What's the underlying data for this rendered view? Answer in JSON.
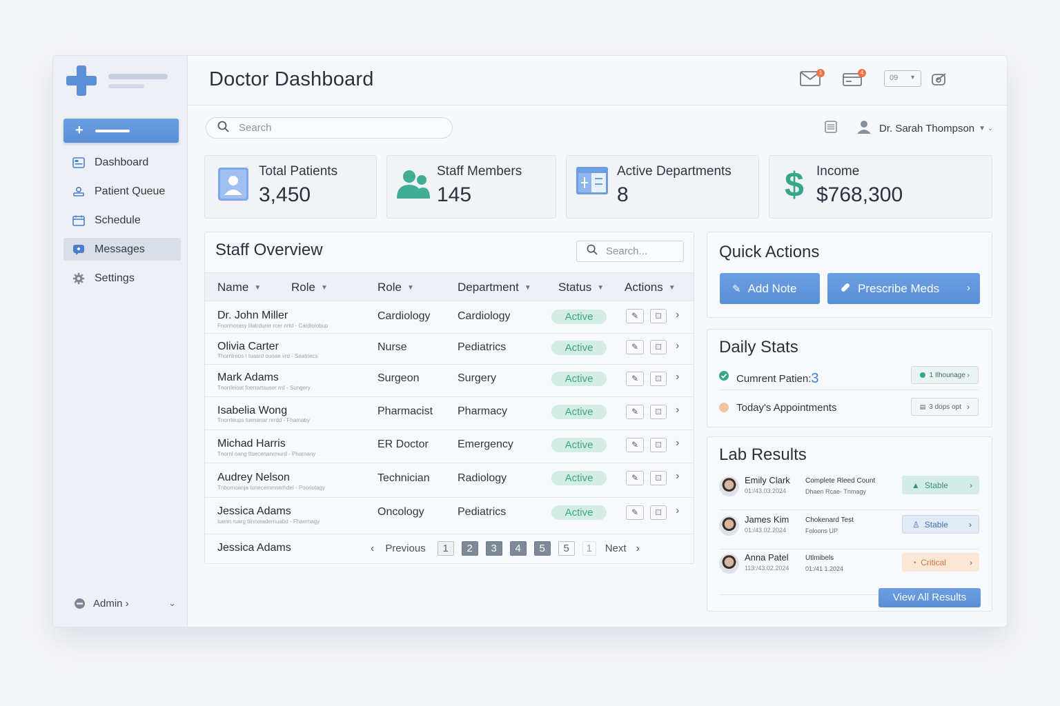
{
  "colors": {
    "accent": "#5b8fd8",
    "status_active_bg": "#d3ede4",
    "status_active_text": "#3ba58a",
    "critical": "#d2733d",
    "badge": "#ef7248"
  },
  "sidebar": {
    "items": [
      {
        "label": "Dashboard",
        "icon": "dashboard-icon"
      },
      {
        "label": "Patient Queue",
        "icon": "queue-icon"
      },
      {
        "label": "Schedule",
        "icon": "calendar-icon"
      },
      {
        "label": "Messages",
        "icon": "message-icon",
        "active": true
      },
      {
        "label": "Settings",
        "icon": "gear-icon"
      }
    ],
    "admin_label": "Admin ›"
  },
  "header": {
    "title": "Doctor Dashboard",
    "mail_badge": "1",
    "inbox_badge": "4",
    "lang_value": "09"
  },
  "search": {
    "placeholder": "Search"
  },
  "user": {
    "name": "Dr. Sarah Thompson"
  },
  "stats": [
    {
      "label": "Total Patients",
      "value": "3,450",
      "icon": "patient-icon"
    },
    {
      "label": "Staff Members",
      "value": "145",
      "icon": "staff-icon"
    },
    {
      "label": "Active Departments",
      "value": "8",
      "icon": "departments-icon"
    },
    {
      "label": "Income",
      "value": "$768,300",
      "icon": "dollar-icon"
    }
  ],
  "staff": {
    "title": "Staff Overview",
    "search_placeholder": "Search...",
    "columns": [
      "Name",
      "Role",
      "Role",
      "Department",
      "Status",
      "Actions"
    ],
    "rows": [
      {
        "name": "Dr. John Miller",
        "sub": "Fnormorasy lilatrdurer rcer nrtd - Cardiolobup",
        "role": "Cardiology",
        "dept": "Cardiology",
        "status": "Active"
      },
      {
        "name": "Olivia Carter",
        "sub": "Thornlreos I  tuasrd ouoae vrd - Seatrlecs",
        "role": "Nurse",
        "dept": "Pediatrics",
        "status": "Active"
      },
      {
        "name": "Mark Adams",
        "sub": "Tnorrleioat  foerrartsuser rrd - Sungery",
        "role": "Surgeon",
        "dept": "Surgery",
        "status": "Active"
      },
      {
        "name": "Isabelia Wong",
        "sub": "Tnorrteups  tuenariar nrrdd - Fhamaby",
        "role": "Pharmacist",
        "dept": "Pharmacy",
        "status": "Active"
      },
      {
        "name": "Michad Harris",
        "sub": "Tnornl oang  ttuecenanrmurd - Pharnany",
        "role": "ER Doctor",
        "dept": "Emergency",
        "status": "Active"
      },
      {
        "name": "Audrey Nelson",
        "sub": "Tnbornoanja  tuneceinmnnrhdel - Pooriotagy",
        "role": "Technician",
        "dept": "Radiology",
        "status": "Active"
      },
      {
        "name": "Jessica Adams",
        "sub": "Iuenn ruarg  tiinrxeadernuabd - Fhaernagy",
        "role": "Oncology",
        "dept": "Pediatrics",
        "status": "Active"
      }
    ],
    "footer_name": "Jessica Adams",
    "pager": {
      "previous": "Previous",
      "next": "Next",
      "pages": [
        "1",
        "2",
        "3",
        "4",
        "5",
        "5",
        "1"
      ]
    }
  },
  "quick_actions": {
    "title": "Quick Actions",
    "add_note": "Add Note",
    "prescribe": "Prescribe Meds"
  },
  "daily_stats": {
    "title": "Daily Stats",
    "current_label": "Cumrent Patien:",
    "current_value": "3",
    "current_pill": "1 Ilhounage ›",
    "appointments_label": "Today's Appointments",
    "appointments_pill": "3 dops opt"
  },
  "lab_results": {
    "title": "Lab Results",
    "rows": [
      {
        "patient": "Emily Clark",
        "date": "01:/43.03.2024",
        "test": "Complete Rleed Count",
        "detail": "Dhaen Rcae- Tnmagy",
        "status": "Stable",
        "kind": "stable"
      },
      {
        "patient": "James Kim",
        "date": "01:/43.02.2024",
        "test": "Chokenard Test",
        "detail": "Foloons UP",
        "status": "Stable",
        "kind": "stable2"
      },
      {
        "patient": "Anna Patel",
        "date": "113:/43.02.2024",
        "test": "Utlmibels",
        "detail": "01:/41 1.2024",
        "status": "Critical",
        "kind": "critical"
      }
    ],
    "view_all": "View All Results"
  }
}
